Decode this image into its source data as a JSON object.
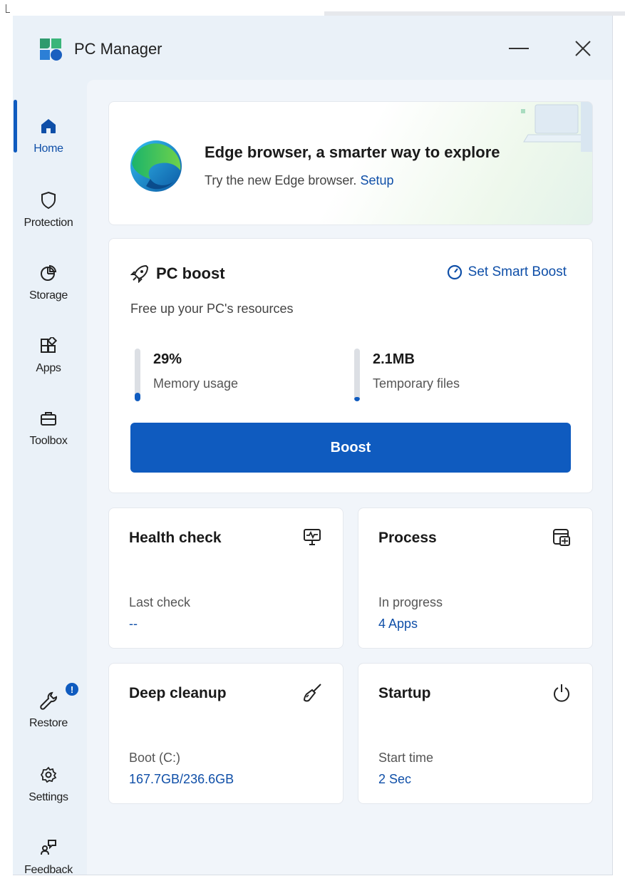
{
  "window": {
    "title": "PC Manager"
  },
  "sidebar": {
    "items": [
      {
        "label": "Home",
        "icon": "home-icon"
      },
      {
        "label": "Protection",
        "icon": "shield-icon"
      },
      {
        "label": "Storage",
        "icon": "pie-chart-icon"
      },
      {
        "label": "Apps",
        "icon": "apps-icon"
      },
      {
        "label": "Toolbox",
        "icon": "toolbox-icon"
      },
      {
        "label": "Restore",
        "icon": "wrench-icon"
      },
      {
        "label": "Settings",
        "icon": "gear-icon"
      },
      {
        "label": "Feedback",
        "icon": "feedback-icon"
      }
    ],
    "restore_badge": "!"
  },
  "edge_card": {
    "title": "Edge browser, a smarter way to explore",
    "subtitle": "Try the new Edge browser.",
    "link": "Setup"
  },
  "boost_card": {
    "title": "PC boost",
    "smart_boost": "Set Smart Boost",
    "subtitle": "Free up your PC's resources",
    "memory": {
      "value": "29%",
      "label": "Memory usage",
      "fill_fraction": 0.16
    },
    "temp": {
      "value": "2.1MB",
      "label": "Temporary files",
      "fill_fraction": 0.08
    },
    "button": "Boost"
  },
  "health_card": {
    "title": "Health check",
    "label": "Last check",
    "value": "--"
  },
  "process_card": {
    "title": "Process",
    "label": "In progress",
    "value": "4 Apps"
  },
  "cleanup_card": {
    "title": "Deep cleanup",
    "label": "Boot (C:)",
    "value": "167.7GB/236.6GB"
  },
  "startup_card": {
    "title": "Startup",
    "label": "Start time",
    "value": "2 Sec"
  },
  "colors": {
    "accent": "#0f5bbf",
    "link": "#0f4fa8",
    "background": "#eaf1f8"
  }
}
